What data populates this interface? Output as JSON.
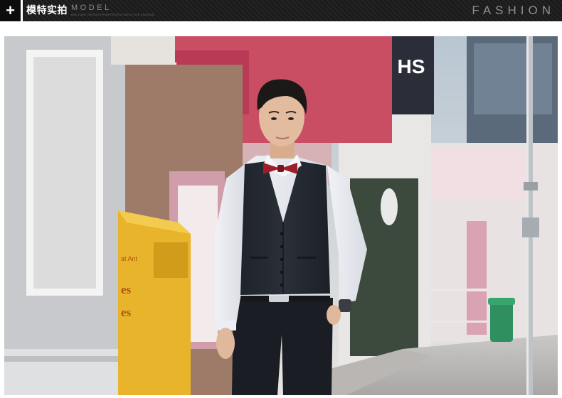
{
  "header": {
    "plus_symbol": "+",
    "title_cn": "模特实拍",
    "title_en": "MODEL",
    "subtitle_en": "BRILLIANT DESIGN FROM PEOPLE WHO LOVE FASHION",
    "fashion_label": "FASHION"
  },
  "photo": {
    "sign_letters": "HS",
    "poster_text": [
      "at Ant",
      "es",
      "es"
    ],
    "subject": "man-in-vest-and-bow-tie"
  },
  "colors": {
    "header_bg": "#1b1b1b",
    "mailbox_yellow": "#e7b42b",
    "awning_red": "#d8485e",
    "vest_navy": "#23272f",
    "bow_tie_red": "#9c1f2a"
  }
}
